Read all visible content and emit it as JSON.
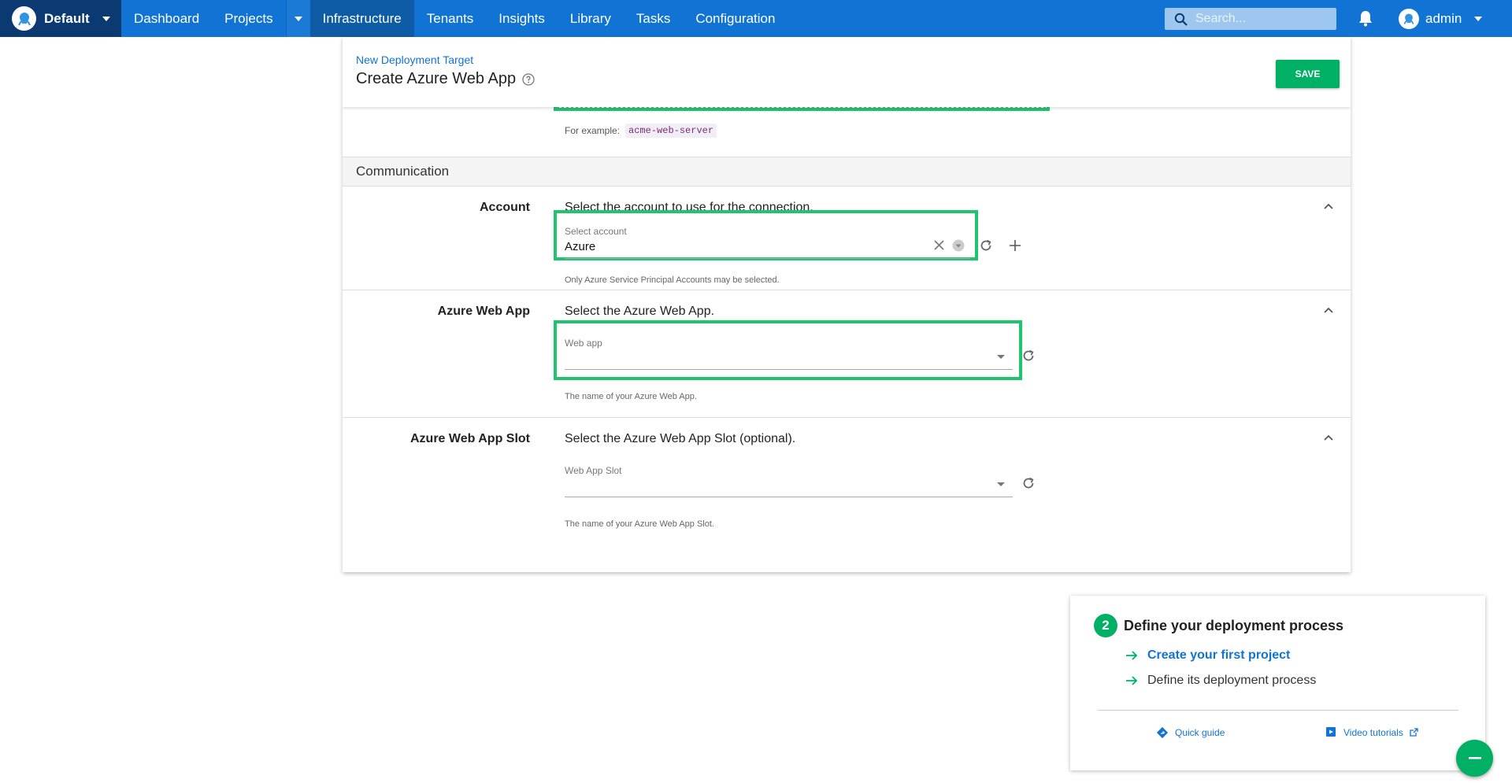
{
  "nav": {
    "space_name": "Default",
    "items": [
      {
        "label": "Dashboard"
      },
      {
        "label": "Projects"
      },
      {
        "label": "Infrastructure"
      },
      {
        "label": "Tenants"
      },
      {
        "label": "Insights"
      },
      {
        "label": "Library"
      },
      {
        "label": "Tasks"
      },
      {
        "label": "Configuration"
      }
    ],
    "active": "Infrastructure",
    "search_placeholder": "Search...",
    "user_name": "admin",
    "colors": {
      "bar": "#1173d3",
      "space_bg": "#0b3a72",
      "active_bg": "#0e5ba6"
    }
  },
  "page": {
    "breadcrumb": "New Deployment Target",
    "title": "Create Azure Web App",
    "save_label": "SAVE",
    "example_prefix": "For example:",
    "example_code": "acme-web-server"
  },
  "section": {
    "title": "Communication"
  },
  "rows": {
    "account": {
      "label": "Account",
      "description": "Select the account to use for the connection.",
      "field_label": "Select account",
      "field_value": "Azure",
      "helper": "Only Azure Service Principal Accounts may be selected."
    },
    "web_app": {
      "label": "Azure Web App",
      "description": "Select the Azure Web App.",
      "field_label": "Web app",
      "field_value": "",
      "helper": "The name of your Azure Web App."
    },
    "slot": {
      "label": "Azure Web App Slot",
      "description": "Select the Azure Web App Slot (optional).",
      "field_label": "Web App Slot",
      "field_value": "",
      "helper": "The name of your Azure Web App Slot."
    }
  },
  "onboarding": {
    "step_number": "2",
    "title": "Define your deployment process",
    "items": [
      {
        "label": "Create your first project",
        "link": true
      },
      {
        "label": "Define its deployment process",
        "link": false
      }
    ],
    "quick_guide": "Quick guide",
    "video_tutorials": "Video tutorials"
  },
  "colors": {
    "accent_green": "#00b065",
    "highlight_green": "#1ec56d",
    "link_blue": "#1173d3"
  }
}
